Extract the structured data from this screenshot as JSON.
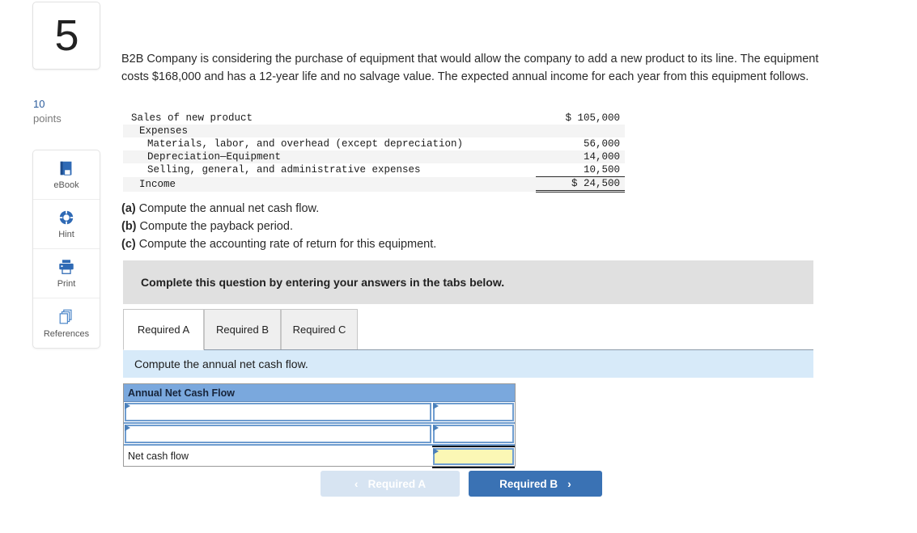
{
  "question": {
    "number": "5",
    "points_value": "10",
    "points_label": "points",
    "prompt": "B2B Company is considering the purchase of equipment that would allow the company to add a new product to its line. The equipment costs $168,000 and has a 12-year life and no salvage value. The expected annual income for each year from this equipment follows."
  },
  "tools": [
    {
      "label": "eBook",
      "icon": "book-icon"
    },
    {
      "label": "Hint",
      "icon": "lifebuoy-icon"
    },
    {
      "label": "Print",
      "icon": "printer-icon"
    },
    {
      "label": "References",
      "icon": "copy-pages-icon"
    }
  ],
  "financials": {
    "rows": [
      {
        "label": "Sales of new product",
        "indent": 0,
        "amount": "$ 105,000",
        "shaded": false,
        "rule_top": false,
        "rule_double": false
      },
      {
        "label": "Expenses",
        "indent": 1,
        "amount": "",
        "shaded": true,
        "rule_top": false,
        "rule_double": false
      },
      {
        "label": "Materials, labor, and overhead (except depreciation)",
        "indent": 2,
        "amount": "56,000",
        "shaded": false,
        "rule_top": false,
        "rule_double": false
      },
      {
        "label": "Depreciation—Equipment",
        "indent": 2,
        "amount": "14,000",
        "shaded": true,
        "rule_top": false,
        "rule_double": false
      },
      {
        "label": "Selling, general, and administrative expenses",
        "indent": 2,
        "amount": "10,500",
        "shaded": false,
        "rule_top": false,
        "rule_double": false
      },
      {
        "label": "Income",
        "indent": 1,
        "amount": "$ 24,500",
        "shaded": true,
        "rule_top": true,
        "rule_double": true
      }
    ]
  },
  "requirements": [
    {
      "marker": "(a)",
      "text": "Compute the annual net cash flow."
    },
    {
      "marker": "(b)",
      "text": "Compute the payback period."
    },
    {
      "marker": "(c)",
      "text": "Compute the accounting rate of return for this equipment."
    }
  ],
  "instruction_band": {
    "text": "Complete this question by entering your answers in the tabs below."
  },
  "tabs": [
    {
      "label": "Required A",
      "active": true
    },
    {
      "label": "Required B",
      "active": false
    },
    {
      "label": "Required C",
      "active": false
    }
  ],
  "tab_instruction": {
    "text": "Compute the annual net cash flow."
  },
  "answer_grid": {
    "header": "Annual Net Cash Flow",
    "rows": [
      {
        "type": "input",
        "label": "",
        "value": "",
        "highlight": false
      },
      {
        "type": "input",
        "label": "",
        "value": "",
        "highlight": false
      },
      {
        "type": "total",
        "label": "Net cash flow",
        "value": "",
        "highlight": true
      }
    ]
  },
  "nav": {
    "prev_label": "Required A",
    "prev_chevron": "‹",
    "next_label": "Required B",
    "next_chevron": "›"
  },
  "colors": {
    "accent_blue": "#3a72b4",
    "table_header_blue": "#7aa8dd",
    "tab_band_blue": "#d7eaf9",
    "instruction_gray": "#e0e0e0",
    "input_highlight_yellow": "#fbf7b5",
    "input_border_blue": "#6f9dd0",
    "points_blue": "#2b5c9c"
  }
}
